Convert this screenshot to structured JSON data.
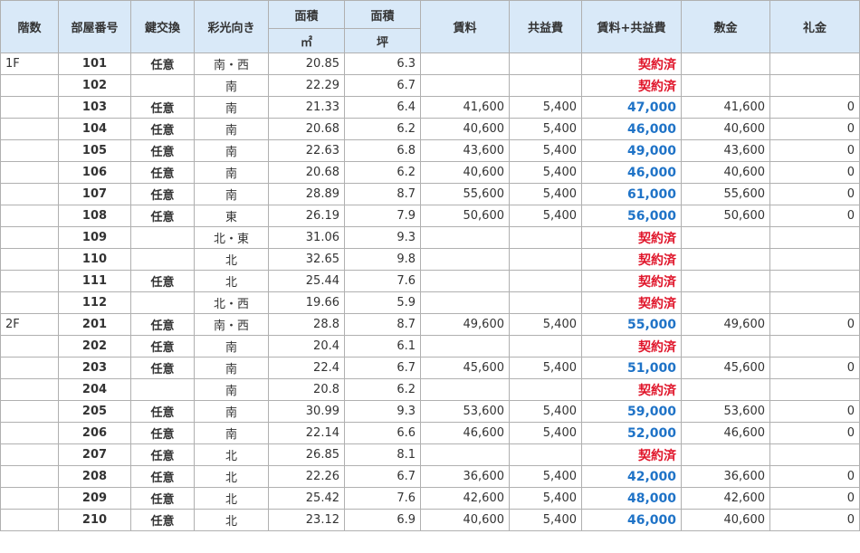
{
  "colors": {
    "header_bg": "#d9e9f8",
    "border": "#b0b0b0",
    "price_blue": "#1f73c7",
    "contracted_red": "#e0162b"
  },
  "headers": {
    "floor": "階数",
    "room": "部屋番号",
    "key": "鍵交換",
    "direction": "彩光向き",
    "area_m2": "面積",
    "area_tsubo": "面積",
    "unit_m2": "㎡",
    "unit_tsubo": "坪",
    "rent": "賃料",
    "fee": "共益費",
    "total": "賃料+共益費",
    "deposit": "敷金",
    "key_money": "礼金"
  },
  "rows": [
    {
      "floor": "1F",
      "room": "101",
      "key": "任意",
      "direction": "南・西",
      "m2": "20.85",
      "tsubo": "6.3",
      "rent": "",
      "fee": "",
      "total": "契約済",
      "status": "contracted",
      "deposit": "",
      "key_money": ""
    },
    {
      "floor": "",
      "room": "102",
      "key": "",
      "direction": "南",
      "m2": "22.29",
      "tsubo": "6.7",
      "rent": "",
      "fee": "",
      "total": "契約済",
      "status": "contracted",
      "deposit": "",
      "key_money": ""
    },
    {
      "floor": "",
      "room": "103",
      "key": "任意",
      "direction": "南",
      "m2": "21.33",
      "tsubo": "6.4",
      "rent": "41,600",
      "fee": "5,400",
      "total": "47,000",
      "status": "open",
      "deposit": "41,600",
      "key_money": "0"
    },
    {
      "floor": "",
      "room": "104",
      "key": "任意",
      "direction": "南",
      "m2": "20.68",
      "tsubo": "6.2",
      "rent": "40,600",
      "fee": "5,400",
      "total": "46,000",
      "status": "open",
      "deposit": "40,600",
      "key_money": "0"
    },
    {
      "floor": "",
      "room": "105",
      "key": "任意",
      "direction": "南",
      "m2": "22.63",
      "tsubo": "6.8",
      "rent": "43,600",
      "fee": "5,400",
      "total": "49,000",
      "status": "open",
      "deposit": "43,600",
      "key_money": "0"
    },
    {
      "floor": "",
      "room": "106",
      "key": "任意",
      "direction": "南",
      "m2": "20.68",
      "tsubo": "6.2",
      "rent": "40,600",
      "fee": "5,400",
      "total": "46,000",
      "status": "open",
      "deposit": "40,600",
      "key_money": "0"
    },
    {
      "floor": "",
      "room": "107",
      "key": "任意",
      "direction": "南",
      "m2": "28.89",
      "tsubo": "8.7",
      "rent": "55,600",
      "fee": "5,400",
      "total": "61,000",
      "status": "open",
      "deposit": "55,600",
      "key_money": "0"
    },
    {
      "floor": "",
      "room": "108",
      "key": "任意",
      "direction": "東",
      "m2": "26.19",
      "tsubo": "7.9",
      "rent": "50,600",
      "fee": "5,400",
      "total": "56,000",
      "status": "open",
      "deposit": "50,600",
      "key_money": "0"
    },
    {
      "floor": "",
      "room": "109",
      "key": "",
      "direction": "北・東",
      "m2": "31.06",
      "tsubo": "9.3",
      "rent": "",
      "fee": "",
      "total": "契約済",
      "status": "contracted",
      "deposit": "",
      "key_money": ""
    },
    {
      "floor": "",
      "room": "110",
      "key": "",
      "direction": "北",
      "m2": "32.65",
      "tsubo": "9.8",
      "rent": "",
      "fee": "",
      "total": "契約済",
      "status": "contracted",
      "deposit": "",
      "key_money": ""
    },
    {
      "floor": "",
      "room": "111",
      "key": "任意",
      "direction": "北",
      "m2": "25.44",
      "tsubo": "7.6",
      "rent": "",
      "fee": "",
      "total": "契約済",
      "status": "contracted",
      "deposit": "",
      "key_money": ""
    },
    {
      "floor": "",
      "room": "112",
      "key": "",
      "direction": "北・西",
      "m2": "19.66",
      "tsubo": "5.9",
      "rent": "",
      "fee": "",
      "total": "契約済",
      "status": "contracted",
      "deposit": "",
      "key_money": ""
    },
    {
      "floor": "2F",
      "room": "201",
      "key": "任意",
      "direction": "南・西",
      "m2": "28.8",
      "tsubo": "8.7",
      "rent": "49,600",
      "fee": "5,400",
      "total": "55,000",
      "status": "open",
      "deposit": "49,600",
      "key_money": "0"
    },
    {
      "floor": "",
      "room": "202",
      "key": "任意",
      "direction": "南",
      "m2": "20.4",
      "tsubo": "6.1",
      "rent": "",
      "fee": "",
      "total": "契約済",
      "status": "contracted",
      "deposit": "",
      "key_money": ""
    },
    {
      "floor": "",
      "room": "203",
      "key": "任意",
      "direction": "南",
      "m2": "22.4",
      "tsubo": "6.7",
      "rent": "45,600",
      "fee": "5,400",
      "total": "51,000",
      "status": "open",
      "deposit": "45,600",
      "key_money": "0"
    },
    {
      "floor": "",
      "room": "204",
      "key": "",
      "direction": "南",
      "m2": "20.8",
      "tsubo": "6.2",
      "rent": "",
      "fee": "",
      "total": "契約済",
      "status": "contracted",
      "deposit": "",
      "key_money": ""
    },
    {
      "floor": "",
      "room": "205",
      "key": "任意",
      "direction": "南",
      "m2": "30.99",
      "tsubo": "9.3",
      "rent": "53,600",
      "fee": "5,400",
      "total": "59,000",
      "status": "open",
      "deposit": "53,600",
      "key_money": "0"
    },
    {
      "floor": "",
      "room": "206",
      "key": "任意",
      "direction": "南",
      "m2": "22.14",
      "tsubo": "6.6",
      "rent": "46,600",
      "fee": "5,400",
      "total": "52,000",
      "status": "open",
      "deposit": "46,600",
      "key_money": "0"
    },
    {
      "floor": "",
      "room": "207",
      "key": "任意",
      "direction": "北",
      "m2": "26.85",
      "tsubo": "8.1",
      "rent": "",
      "fee": "",
      "total": "契約済",
      "status": "contracted",
      "deposit": "",
      "key_money": ""
    },
    {
      "floor": "",
      "room": "208",
      "key": "任意",
      "direction": "北",
      "m2": "22.26",
      "tsubo": "6.7",
      "rent": "36,600",
      "fee": "5,400",
      "total": "42,000",
      "status": "open",
      "deposit": "36,600",
      "key_money": "0"
    },
    {
      "floor": "",
      "room": "209",
      "key": "任意",
      "direction": "北",
      "m2": "25.42",
      "tsubo": "7.6",
      "rent": "42,600",
      "fee": "5,400",
      "total": "48,000",
      "status": "open",
      "deposit": "42,600",
      "key_money": "0"
    },
    {
      "floor": "",
      "room": "210",
      "key": "任意",
      "direction": "北",
      "m2": "23.12",
      "tsubo": "6.9",
      "rent": "40,600",
      "fee": "5,400",
      "total": "46,000",
      "status": "open",
      "deposit": "40,600",
      "key_money": "0"
    }
  ]
}
